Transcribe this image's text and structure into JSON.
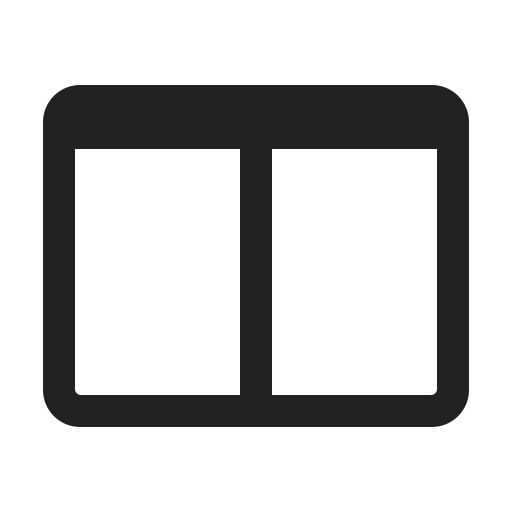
{
  "icon": {
    "name": "split-window-icon",
    "color": "#212121",
    "background": "#ffffff"
  }
}
